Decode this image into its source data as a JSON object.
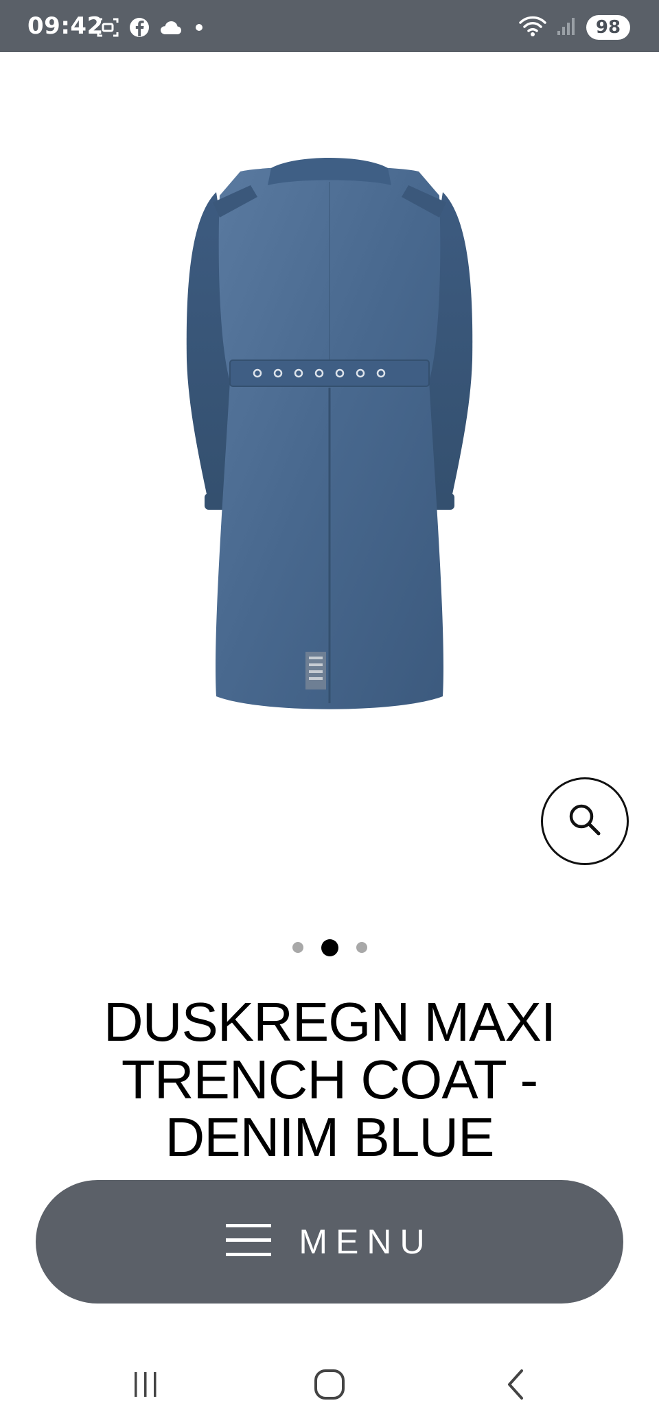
{
  "status_bar": {
    "time": "09:42",
    "battery": "98",
    "icons": [
      "screenshot-icon",
      "facebook-icon",
      "cloud-icon",
      "dot-icon",
      "wifi-icon",
      "signal-icon",
      "battery-icon"
    ]
  },
  "product": {
    "image_alt": "Back view of blue denim trench coat",
    "title": "DUSKREGN MAXI TRENCH COAT - DENIM BLUE",
    "carousel": {
      "total": 3,
      "active": 2
    }
  },
  "menu": {
    "label": "MENU"
  },
  "colors": {
    "status_bar_bg": "#5a6068",
    "menu_bg": "#5b6068",
    "denim": "#4a6a8e"
  }
}
